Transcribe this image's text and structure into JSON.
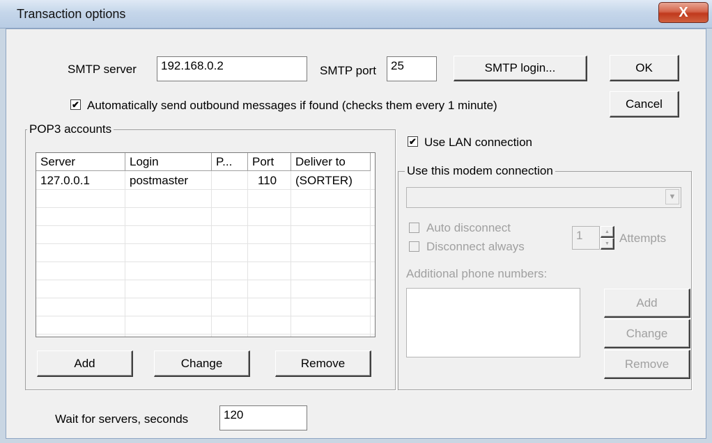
{
  "window": {
    "title": "Transaction options",
    "close_glyph": "X"
  },
  "smtp": {
    "server_label": "SMTP server",
    "server_value": "192.168.0.2",
    "port_label": "SMTP port",
    "port_value": "25",
    "login_button": "SMTP login..."
  },
  "buttons": {
    "ok": "OK",
    "cancel": "Cancel"
  },
  "auto_send": {
    "checked": true,
    "label": "Automatically send outbound messages if found (checks them every 1 minute)"
  },
  "pop3": {
    "group_label": "POP3 accounts",
    "columns": [
      "Server",
      "Login",
      "P...",
      "Port",
      "Deliver to"
    ],
    "rows": [
      [
        "127.0.0.1",
        "postmaster",
        "",
        "110",
        "(SORTER)"
      ]
    ],
    "add": "Add",
    "change": "Change",
    "remove": "Remove"
  },
  "lan": {
    "checked": true,
    "label": "Use LAN connection"
  },
  "modem": {
    "group_label": "Use this modem connection",
    "selected": "",
    "auto_disconnect": {
      "checked": false,
      "label": "Auto disconnect"
    },
    "disconnect_always": {
      "checked": false,
      "label": "Disconnect always"
    },
    "attempts_value": "1",
    "attempts_label": "Attempts",
    "phones_label": "Additional phone numbers:",
    "add": "Add",
    "change": "Change",
    "remove": "Remove"
  },
  "wait": {
    "label": "Wait for servers, seconds",
    "value": "120"
  },
  "icons": {
    "check": "✔",
    "dropdown": "▼",
    "spin_up": "▲",
    "spin_down": "▼"
  }
}
